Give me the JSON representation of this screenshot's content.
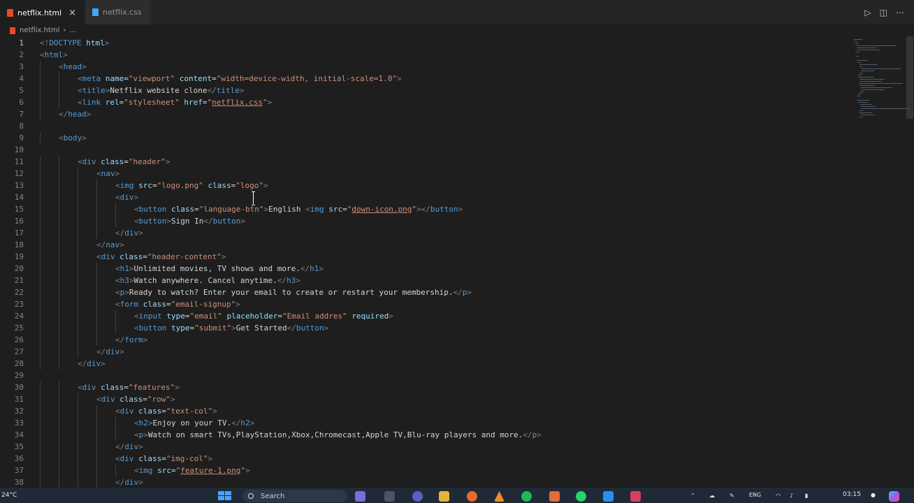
{
  "tabs": [
    {
      "label": "netflix.html",
      "active": true,
      "icon": "html-file-icon"
    },
    {
      "label": "netflix.css",
      "active": false,
      "icon": "css-file-icon"
    }
  ],
  "tab_close_glyph": "×",
  "breadcrumb": {
    "file": "netflix.html",
    "separator": "›",
    "rest": "..."
  },
  "editor": {
    "current_line": 1,
    "lines": [
      {
        "n": 1,
        "indent": 0,
        "tokens": [
          [
            "br",
            "<!"
          ],
          [
            "tag",
            "DOCTYPE"
          ],
          [
            "txt",
            " "
          ],
          [
            "attr",
            "html"
          ],
          [
            "br",
            ">"
          ]
        ]
      },
      {
        "n": 2,
        "indent": 0,
        "tokens": [
          [
            "br",
            "<"
          ],
          [
            "tag",
            "html"
          ],
          [
            "br",
            ">"
          ]
        ]
      },
      {
        "n": 3,
        "indent": 1,
        "tokens": [
          [
            "br",
            "<"
          ],
          [
            "tag",
            "head"
          ],
          [
            "br",
            ">"
          ]
        ]
      },
      {
        "n": 4,
        "indent": 2,
        "tokens": [
          [
            "br",
            "<"
          ],
          [
            "tag",
            "meta"
          ],
          [
            "txt",
            " "
          ],
          [
            "attr",
            "name"
          ],
          [
            "txt",
            "="
          ],
          [
            "str",
            "\"viewport\""
          ],
          [
            "txt",
            " "
          ],
          [
            "attr",
            "content"
          ],
          [
            "txt",
            "="
          ],
          [
            "str",
            "\"width=device-width, initial-scale=1.0\""
          ],
          [
            "br",
            ">"
          ]
        ]
      },
      {
        "n": 5,
        "indent": 2,
        "tokens": [
          [
            "br",
            "<"
          ],
          [
            "tag",
            "title"
          ],
          [
            "br",
            ">"
          ],
          [
            "txt",
            "Netflix website clone"
          ],
          [
            "br",
            "</"
          ],
          [
            "tag",
            "title"
          ],
          [
            "br",
            ">"
          ]
        ]
      },
      {
        "n": 6,
        "indent": 2,
        "tokens": [
          [
            "br",
            "<"
          ],
          [
            "tag",
            "link"
          ],
          [
            "txt",
            " "
          ],
          [
            "attr",
            "rel"
          ],
          [
            "txt",
            "="
          ],
          [
            "str",
            "\"stylesheet\""
          ],
          [
            "txt",
            " "
          ],
          [
            "attr",
            "href"
          ],
          [
            "txt",
            "="
          ],
          [
            "str",
            "\""
          ],
          [
            "link",
            "netflix.css"
          ],
          [
            "str",
            "\""
          ],
          [
            "br",
            ">"
          ]
        ]
      },
      {
        "n": 7,
        "indent": 1,
        "tokens": [
          [
            "br",
            "</"
          ],
          [
            "tag",
            "head"
          ],
          [
            "br",
            ">"
          ]
        ]
      },
      {
        "n": 8,
        "indent": 0,
        "tokens": []
      },
      {
        "n": 9,
        "indent": 1,
        "tokens": [
          [
            "br",
            "<"
          ],
          [
            "tag",
            "body"
          ],
          [
            "br",
            ">"
          ]
        ]
      },
      {
        "n": 10,
        "indent": 0,
        "tokens": []
      },
      {
        "n": 11,
        "indent": 2,
        "tokens": [
          [
            "br",
            "<"
          ],
          [
            "tag",
            "div"
          ],
          [
            "txt",
            " "
          ],
          [
            "attr",
            "class"
          ],
          [
            "txt",
            "="
          ],
          [
            "str",
            "\"header\""
          ],
          [
            "br",
            ">"
          ]
        ]
      },
      {
        "n": 12,
        "indent": 3,
        "tokens": [
          [
            "br",
            "<"
          ],
          [
            "tag",
            "nav"
          ],
          [
            "br",
            ">"
          ]
        ]
      },
      {
        "n": 13,
        "indent": 4,
        "tokens": [
          [
            "br",
            "<"
          ],
          [
            "tag",
            "img"
          ],
          [
            "txt",
            " "
          ],
          [
            "attr",
            "src"
          ],
          [
            "txt",
            "="
          ],
          [
            "str",
            "\"logo.png\""
          ],
          [
            "txt",
            " "
          ],
          [
            "attr",
            "class"
          ],
          [
            "txt",
            "="
          ],
          [
            "str",
            "\"logo\""
          ],
          [
            "br",
            ">"
          ]
        ]
      },
      {
        "n": 14,
        "indent": 4,
        "tokens": [
          [
            "br",
            "<"
          ],
          [
            "tag",
            "div"
          ],
          [
            "br",
            ">"
          ]
        ]
      },
      {
        "n": 15,
        "indent": 5,
        "tokens": [
          [
            "br",
            "<"
          ],
          [
            "tag",
            "button"
          ],
          [
            "txt",
            " "
          ],
          [
            "attr",
            "class"
          ],
          [
            "txt",
            "="
          ],
          [
            "str",
            "\"language-btn\""
          ],
          [
            "br",
            ">"
          ],
          [
            "txt",
            "English "
          ],
          [
            "br",
            "<"
          ],
          [
            "tag",
            "img"
          ],
          [
            "txt",
            " "
          ],
          [
            "attr",
            "src"
          ],
          [
            "txt",
            "="
          ],
          [
            "str",
            "\""
          ],
          [
            "link",
            "down-icon.png"
          ],
          [
            "str",
            "\""
          ],
          [
            "br",
            "></"
          ],
          [
            "tag",
            "button"
          ],
          [
            "br",
            ">"
          ]
        ]
      },
      {
        "n": 16,
        "indent": 5,
        "tokens": [
          [
            "br",
            "<"
          ],
          [
            "tag",
            "button"
          ],
          [
            "br",
            ">"
          ],
          [
            "txt",
            "Sign In"
          ],
          [
            "br",
            "</"
          ],
          [
            "tag",
            "button"
          ],
          [
            "br",
            ">"
          ]
        ]
      },
      {
        "n": 17,
        "indent": 4,
        "tokens": [
          [
            "br",
            "</"
          ],
          [
            "tag",
            "div"
          ],
          [
            "br",
            ">"
          ]
        ]
      },
      {
        "n": 18,
        "indent": 3,
        "tokens": [
          [
            "br",
            "</"
          ],
          [
            "tag",
            "nav"
          ],
          [
            "br",
            ">"
          ]
        ]
      },
      {
        "n": 19,
        "indent": 3,
        "tokens": [
          [
            "br",
            "<"
          ],
          [
            "tag",
            "div"
          ],
          [
            "txt",
            " "
          ],
          [
            "attr",
            "class"
          ],
          [
            "txt",
            "="
          ],
          [
            "str",
            "\"header-content\""
          ],
          [
            "br",
            ">"
          ]
        ]
      },
      {
        "n": 20,
        "indent": 4,
        "tokens": [
          [
            "br",
            "<"
          ],
          [
            "tag",
            "h1"
          ],
          [
            "br",
            ">"
          ],
          [
            "txt",
            "Unlimited movies, TV shows and more."
          ],
          [
            "br",
            "</"
          ],
          [
            "tag",
            "h1"
          ],
          [
            "br",
            ">"
          ]
        ]
      },
      {
        "n": 21,
        "indent": 4,
        "tokens": [
          [
            "br",
            "<"
          ],
          [
            "tag",
            "h3"
          ],
          [
            "br",
            ">"
          ],
          [
            "txt",
            "Watch anywhere. Cancel anytime."
          ],
          [
            "br",
            "</"
          ],
          [
            "tag",
            "h3"
          ],
          [
            "br",
            ">"
          ]
        ]
      },
      {
        "n": 22,
        "indent": 4,
        "tokens": [
          [
            "br",
            "<"
          ],
          [
            "tag",
            "p"
          ],
          [
            "br",
            ">"
          ],
          [
            "txt",
            "Ready to watch? Enter your email to create or restart your membership."
          ],
          [
            "br",
            "</"
          ],
          [
            "tag",
            "p"
          ],
          [
            "br",
            ">"
          ]
        ]
      },
      {
        "n": 23,
        "indent": 4,
        "tokens": [
          [
            "br",
            "<"
          ],
          [
            "tag",
            "form"
          ],
          [
            "txt",
            " "
          ],
          [
            "attr",
            "class"
          ],
          [
            "txt",
            "="
          ],
          [
            "str",
            "\"email-signup\""
          ],
          [
            "br",
            ">"
          ]
        ]
      },
      {
        "n": 24,
        "indent": 5,
        "tokens": [
          [
            "br",
            "<"
          ],
          [
            "tag",
            "input"
          ],
          [
            "txt",
            " "
          ],
          [
            "attr",
            "type"
          ],
          [
            "txt",
            "="
          ],
          [
            "str",
            "\"email\""
          ],
          [
            "txt",
            " "
          ],
          [
            "attr",
            "placeholder"
          ],
          [
            "txt",
            "="
          ],
          [
            "str",
            "\"Email addres\""
          ],
          [
            "txt",
            " "
          ],
          [
            "attr",
            "required"
          ],
          [
            "br",
            ">"
          ]
        ]
      },
      {
        "n": 25,
        "indent": 5,
        "tokens": [
          [
            "br",
            "<"
          ],
          [
            "tag",
            "button"
          ],
          [
            "txt",
            " "
          ],
          [
            "attr",
            "type"
          ],
          [
            "txt",
            "="
          ],
          [
            "str",
            "\"submit\""
          ],
          [
            "br",
            ">"
          ],
          [
            "txt",
            "Get Started"
          ],
          [
            "br",
            "</"
          ],
          [
            "tag",
            "button"
          ],
          [
            "br",
            ">"
          ]
        ]
      },
      {
        "n": 26,
        "indent": 4,
        "tokens": [
          [
            "br",
            "</"
          ],
          [
            "tag",
            "form"
          ],
          [
            "br",
            ">"
          ]
        ]
      },
      {
        "n": 27,
        "indent": 3,
        "tokens": [
          [
            "br",
            "</"
          ],
          [
            "tag",
            "div"
          ],
          [
            "br",
            ">"
          ]
        ]
      },
      {
        "n": 28,
        "indent": 2,
        "tokens": [
          [
            "br",
            "</"
          ],
          [
            "tag",
            "div"
          ],
          [
            "br",
            ">"
          ]
        ]
      },
      {
        "n": 29,
        "indent": 0,
        "tokens": []
      },
      {
        "n": 30,
        "indent": 2,
        "tokens": [
          [
            "br",
            "<"
          ],
          [
            "tag",
            "div"
          ],
          [
            "txt",
            " "
          ],
          [
            "attr",
            "class"
          ],
          [
            "txt",
            "="
          ],
          [
            "str",
            "\"features\""
          ],
          [
            "br",
            ">"
          ]
        ]
      },
      {
        "n": 31,
        "indent": 3,
        "tokens": [
          [
            "br",
            "<"
          ],
          [
            "tag",
            "div"
          ],
          [
            "txt",
            " "
          ],
          [
            "attr",
            "class"
          ],
          [
            "txt",
            "="
          ],
          [
            "str",
            "\"row\""
          ],
          [
            "br",
            ">"
          ]
        ]
      },
      {
        "n": 32,
        "indent": 4,
        "tokens": [
          [
            "br",
            "<"
          ],
          [
            "tag",
            "div"
          ],
          [
            "txt",
            " "
          ],
          [
            "attr",
            "class"
          ],
          [
            "txt",
            "="
          ],
          [
            "str",
            "\"text-col\""
          ],
          [
            "br",
            ">"
          ]
        ]
      },
      {
        "n": 33,
        "indent": 5,
        "tokens": [
          [
            "br",
            "<"
          ],
          [
            "tag",
            "h2"
          ],
          [
            "br",
            ">"
          ],
          [
            "txt",
            "Enjoy on your TV."
          ],
          [
            "br",
            "</"
          ],
          [
            "tag",
            "h2"
          ],
          [
            "br",
            ">"
          ]
        ]
      },
      {
        "n": 34,
        "indent": 5,
        "tokens": [
          [
            "br",
            "<"
          ],
          [
            "tag",
            "p"
          ],
          [
            "br",
            ">"
          ],
          [
            "txt",
            "Watch on smart TVs,PlayStation,Xbox,Chromecast,Apple TV,Blu-ray players and more."
          ],
          [
            "br",
            "</"
          ],
          [
            "tag",
            "p"
          ],
          [
            "br",
            ">"
          ]
        ]
      },
      {
        "n": 35,
        "indent": 4,
        "tokens": [
          [
            "br",
            "</"
          ],
          [
            "tag",
            "div"
          ],
          [
            "br",
            ">"
          ]
        ]
      },
      {
        "n": 36,
        "indent": 4,
        "tokens": [
          [
            "br",
            "<"
          ],
          [
            "tag",
            "div"
          ],
          [
            "txt",
            " "
          ],
          [
            "attr",
            "class"
          ],
          [
            "txt",
            "="
          ],
          [
            "str",
            "\"img-col\""
          ],
          [
            "br",
            ">"
          ]
        ]
      },
      {
        "n": 37,
        "indent": 5,
        "tokens": [
          [
            "br",
            "<"
          ],
          [
            "tag",
            "img"
          ],
          [
            "txt",
            " "
          ],
          [
            "attr",
            "src"
          ],
          [
            "txt",
            "="
          ],
          [
            "str",
            "\""
          ],
          [
            "link",
            "feature-1.png"
          ],
          [
            "str",
            "\""
          ],
          [
            "br",
            ">"
          ]
        ]
      },
      {
        "n": 38,
        "indent": 4,
        "tokens": [
          [
            "br",
            "</"
          ],
          [
            "tag",
            "div"
          ],
          [
            "br",
            ">"
          ]
        ]
      }
    ]
  },
  "colors": {
    "tag": "#569cd6",
    "bracket": "#808080",
    "attr": "#9cdcfe",
    "string": "#ce9178",
    "text": "#d4d4d4",
    "background": "#1e1e1e"
  },
  "taskbar": {
    "weather": "24°C",
    "search_placeholder": "Search",
    "language": "ENG",
    "time": "03:15",
    "pinned_icons": [
      "widgets-icon",
      "file-explorer-icon",
      "chat-icon",
      "folder-icon",
      "firefox-icon",
      "vlc-icon",
      "spotify-icon",
      "sublime-icon",
      "whatsapp-icon",
      "vscode-icon",
      "store-icon"
    ],
    "tray_icons": [
      "chevron-up-icon",
      "onedrive-icon",
      "pen-icon",
      "wifi-icon",
      "volume-icon",
      "battery-icon"
    ]
  }
}
